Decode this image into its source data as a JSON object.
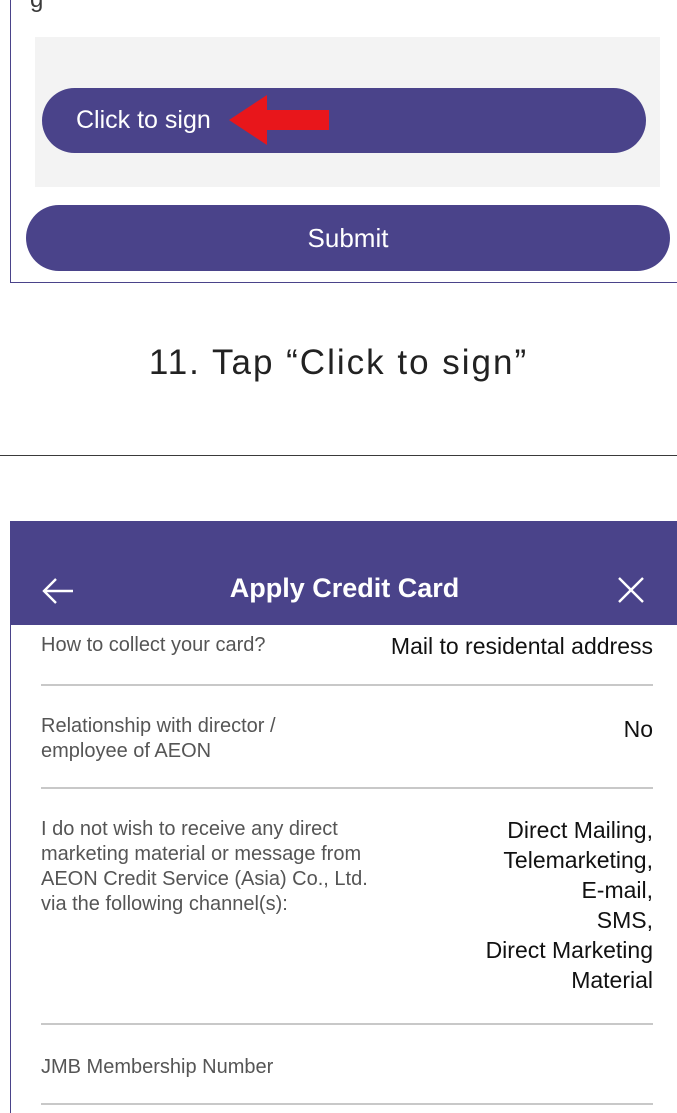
{
  "top_screen": {
    "cutoff_text": "g",
    "sign_button_label": "Click to sign",
    "submit_label": "Submit"
  },
  "caption": "11. Tap “Click to sign”",
  "app": {
    "title": "Apply Credit Card",
    "back_icon": "back-arrow-icon",
    "close_icon": "close-icon",
    "header_color": "#4a438a"
  },
  "fields": [
    {
      "label": "How to collect your card?",
      "value": "Mail to residental address"
    },
    {
      "label_lines": [
        "Relationship with director /",
        "employee of AEON"
      ],
      "value": "No"
    },
    {
      "label_lines": [
        "I do not wish to receive any direct",
        "marketing material or message from",
        "AEON Credit Service (Asia) Co., Ltd.",
        "via the following channel(s):"
      ],
      "value_lines": [
        "Direct Mailing,",
        "Telemarketing,",
        "E-mail,",
        "SMS,",
        "Direct Marketing",
        "Material"
      ]
    },
    {
      "label": "JMB Membership Number",
      "value": ""
    }
  ],
  "colors": {
    "accent": "#4a438a",
    "arrow": "#e8161b",
    "sign_area": "#f3f3f3"
  }
}
